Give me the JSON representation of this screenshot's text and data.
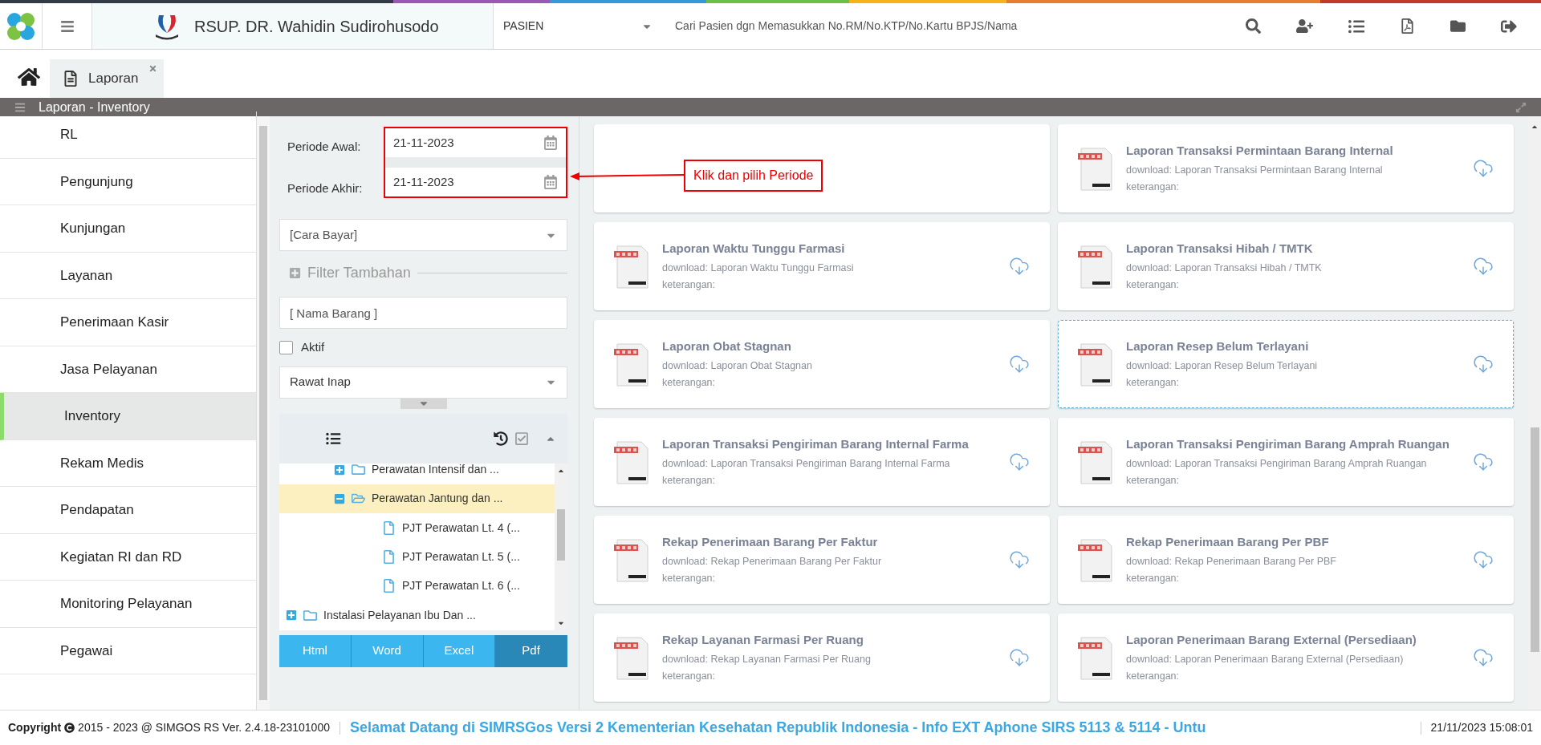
{
  "header": {
    "hospital_name": "RSUP. DR. Wahidin Sudirohusodo",
    "search_type": "PASIEN",
    "search_placeholder": "Cari Pasien dgn Memasukkan No.RM/No.KTP/No.Kartu BPJS/Nama"
  },
  "tabs": [
    {
      "label": "Laporan",
      "selected": true
    }
  ],
  "section_title": "Laporan - Inventory",
  "menu": [
    {
      "label": "RL",
      "selected": false
    },
    {
      "label": "Pengunjung",
      "selected": false
    },
    {
      "label": "Kunjungan",
      "selected": false
    },
    {
      "label": "Layanan",
      "selected": false
    },
    {
      "label": "Penerimaan Kasir",
      "selected": false
    },
    {
      "label": "Jasa Pelayanan",
      "selected": false
    },
    {
      "label": "Inventory",
      "selected": true
    },
    {
      "label": "Rekam Medis",
      "selected": false
    },
    {
      "label": "Pendapatan",
      "selected": false
    },
    {
      "label": "Kegiatan RI dan RD",
      "selected": false
    },
    {
      "label": "Monitoring Pelayanan",
      "selected": false
    },
    {
      "label": "Pegawai",
      "selected": false
    }
  ],
  "filters": {
    "periode_awal": {
      "label": "Periode Awal:",
      "value": "21-11-2023"
    },
    "periode_akhir": {
      "label": "Periode Akhir:",
      "value": "21-11-2023"
    },
    "cara_bayar": {
      "placeholder": "[Cara Bayar]"
    },
    "filter_tambahan": "Filter Tambahan",
    "nama_barang": {
      "placeholder": "[ Nama Barang ]"
    },
    "aktif": {
      "label": "Aktif",
      "checked": false
    },
    "jenis": {
      "value": "Rawat Inap"
    }
  },
  "tree": {
    "continued_children": [
      {
        "label": "Perawatan Intensif dan ...",
        "kind": "folder",
        "expanded": false,
        "selected": false
      },
      {
        "label": "Perawatan Jantung dan ...",
        "kind": "folder",
        "expanded": true,
        "selected": true,
        "children": [
          {
            "label": "PJT Perawatan Lt. 4 (...",
            "kind": "file",
            "selected": false
          },
          {
            "label": "PJT Perawatan Lt. 5 (...",
            "kind": "file",
            "selected": false
          },
          {
            "label": "PJT Perawatan Lt. 6 (...",
            "kind": "file",
            "selected": false
          }
        ]
      }
    ],
    "nodes": [
      {
        "label": "Instalasi Pelayanan Ibu Dan ...",
        "kind": "folder",
        "expanded": false,
        "selected": false
      }
    ]
  },
  "export_buttons": [
    {
      "label": "Html",
      "selected": false
    },
    {
      "label": "Word",
      "selected": false
    },
    {
      "label": "Excel",
      "selected": false
    },
    {
      "label": "Pdf",
      "selected": true
    }
  ],
  "annotation": "Klik dan pilih Periode",
  "reports_left": [
    {
      "title": "Laporan Waktu Tunggu Farmasi",
      "download": "download: Laporan Waktu Tunggu Farmasi",
      "note": "keterangan:",
      "focused": false
    },
    {
      "title": "Laporan Obat Stagnan",
      "download": "download: Laporan Obat Stagnan",
      "note": "keterangan:",
      "focused": false
    },
    {
      "title": "Laporan Transaksi Pengiriman Barang Internal Farma",
      "download": "download: Laporan Transaksi Pengiriman Barang Internal Farma",
      "note": "keterangan:",
      "focused": false
    },
    {
      "title": "Rekap Penerimaan Barang Per Faktur",
      "download": "download: Rekap Penerimaan Barang Per Faktur",
      "note": "keterangan:",
      "focused": false
    },
    {
      "title": "Rekap Layanan Farmasi Per Ruang",
      "download": "download: Rekap Layanan Farmasi Per Ruang",
      "note": "keterangan:",
      "focused": false
    }
  ],
  "reports_right": [
    {
      "title": "Laporan Transaksi Permintaan Barang Internal",
      "download": "download: Laporan Transaksi Permintaan Barang Internal",
      "note": "keterangan:",
      "focused": false
    },
    {
      "title": "Laporan Transaksi Hibah / TMTK",
      "download": "download: Laporan Transaksi Hibah / TMTK",
      "note": "keterangan:",
      "focused": false
    },
    {
      "title": "Laporan Resep Belum Terlayani",
      "download": "download: Laporan Resep Belum Terlayani",
      "note": "keterangan:",
      "focused": true
    },
    {
      "title": "Laporan Transaksi Pengiriman Barang Amprah Ruangan",
      "download": "download: Laporan Transaksi Pengiriman Barang Amprah Ruangan",
      "note": "keterangan:",
      "focused": false
    },
    {
      "title": "Rekap Penerimaan Barang Per PBF",
      "download": "download: Rekap Penerimaan Barang Per PBF",
      "note": "keterangan:",
      "focused": false
    },
    {
      "title": "Laporan Penerimaan Barang External (Persediaan)",
      "download": "download: Laporan Penerimaan Barang External (Persediaan)",
      "note": "keterangan:",
      "focused": false
    }
  ],
  "footer": {
    "copyright_label": "Copyright",
    "copyright": "2015 - 2023 @ SIMGOS RS Ver. 2.4.18-23101000",
    "marquee": "Selamat Datang di SIMRSGos Versi 2 Kementerian Kesehatan Republik Indonesia - Info EXT Aphone SIRS 5113 & 5114 - Untu",
    "datetime": "21/11/2023 15:08:01"
  }
}
